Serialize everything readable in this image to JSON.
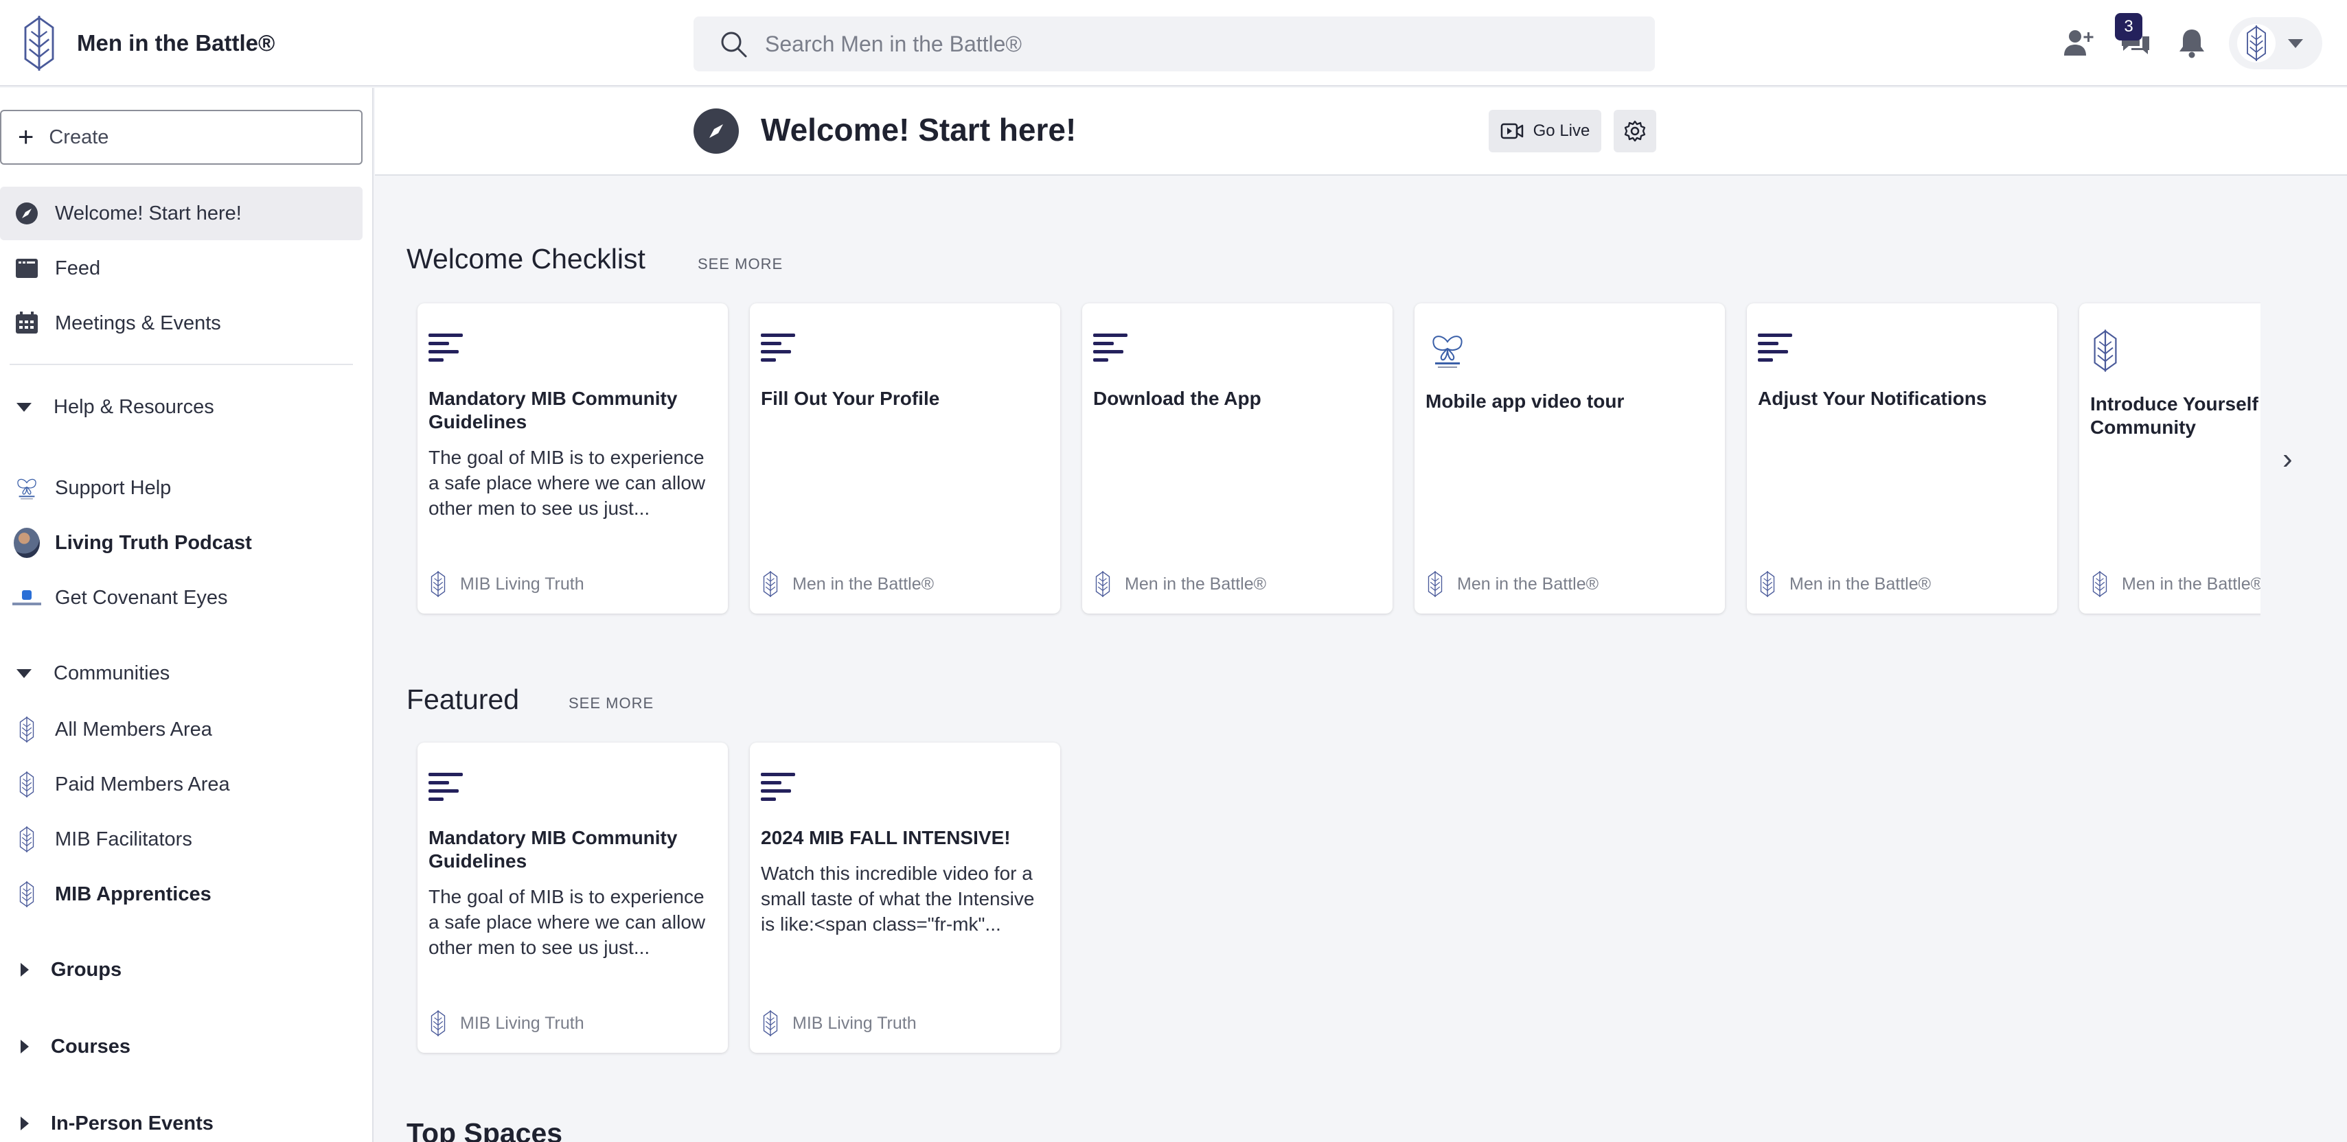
{
  "header": {
    "brand": "Men in the Battle®",
    "search_placeholder": "Search Men in the Battle®",
    "messages_badge": "3"
  },
  "sidebar": {
    "create_label": "Create",
    "top_items": [
      {
        "label": "Welcome! Start here!",
        "icon": "compass-icon",
        "active": true
      },
      {
        "label": "Feed",
        "icon": "feed-icon"
      },
      {
        "label": "Meetings & Events",
        "icon": "calendar-icon"
      }
    ],
    "help_section": {
      "label": "Help & Resources",
      "items": [
        {
          "label": "Support Help",
          "icon": "living-truth-icon"
        },
        {
          "label": "Living Truth Podcast",
          "icon": "podcast-avatar",
          "bold": true
        },
        {
          "label": "Get Covenant Eyes",
          "icon": "covenant-eyes-icon"
        }
      ]
    },
    "communities_section": {
      "label": "Communities",
      "items": [
        {
          "label": "All Members Area",
          "icon": "mib-logo-icon"
        },
        {
          "label": "Paid Members Area",
          "icon": "mib-logo-icon"
        },
        {
          "label": "MIB Facilitators",
          "icon": "mib-logo-icon"
        },
        {
          "label": "MIB Apprentices",
          "icon": "mib-logo-icon",
          "bold": true
        }
      ]
    },
    "collapsed_sections": [
      "Groups",
      "Courses",
      "In-Person Events"
    ]
  },
  "page": {
    "title": "Welcome! Start here!",
    "go_live_label": "Go Live"
  },
  "welcome_checklist": {
    "title": "Welcome Checklist",
    "see_more": "SEE MORE",
    "cards": [
      {
        "title": "Mandatory MIB Community Guidelines",
        "desc": "The goal of MIB is to experience a safe place where we can allow other men to see us just...",
        "footer": "MIB Living Truth"
      },
      {
        "title": "Fill Out Your Profile",
        "desc": "",
        "footer": "Men in the Battle®"
      },
      {
        "title": "Download the App",
        "desc": "",
        "footer": "Men in the Battle®"
      },
      {
        "title": "Mobile app video tour",
        "desc": "",
        "footer": "Men in the Battle®"
      },
      {
        "title": "Adjust Your Notifications",
        "desc": "",
        "footer": "Men in the Battle®"
      },
      {
        "title": "Introduce Yourself to the Community",
        "desc": "",
        "footer": "Men in the Battle®"
      }
    ]
  },
  "featured": {
    "title": "Featured",
    "see_more": "SEE MORE",
    "cards": [
      {
        "title": "Mandatory MIB Community Guidelines",
        "desc": "The goal of MIB is to experience a safe place where we can allow other men to see us just...",
        "footer": "MIB Living Truth"
      },
      {
        "title": "2024 MIB FALL INTENSIVE!",
        "desc": "Watch this incredible video for a small taste of what the Intensive is like:<span class=\"fr-mk\"...",
        "footer": "MIB Living Truth"
      }
    ]
  },
  "top_spaces": {
    "title": "Top Spaces"
  },
  "colors": {
    "brand_dark": "#24215c",
    "accent_blue": "#4a5a9a"
  }
}
